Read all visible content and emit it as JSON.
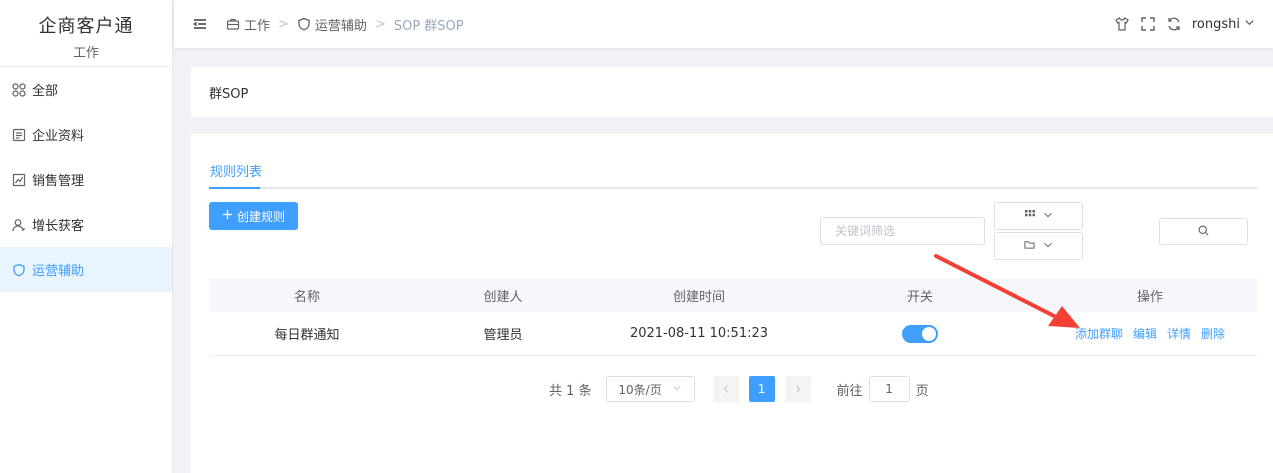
{
  "sidebar": {
    "brand_title": "企商客户通",
    "brand_sub": "工作",
    "items": [
      {
        "label": "全部",
        "icon": "grid-icon"
      },
      {
        "label": "企业资料",
        "icon": "document-icon"
      },
      {
        "label": "销售管理",
        "icon": "chart-icon"
      },
      {
        "label": "增长获客",
        "icon": "user-icon"
      },
      {
        "label": "运营辅助",
        "icon": "shield-icon",
        "active": true
      }
    ]
  },
  "header": {
    "breadcrumb": [
      "工作",
      "运营辅助",
      "SOP 群SOP"
    ],
    "username": "rongshi"
  },
  "page": {
    "title": "群SOP"
  },
  "tabs": [
    {
      "label": "规则列表",
      "active": true
    }
  ],
  "toolbar": {
    "create_label": "创建规则",
    "search_placeholder": "关键词筛选"
  },
  "table": {
    "headers": [
      "名称",
      "创建人",
      "创建时间",
      "开关",
      "操作"
    ],
    "rows": [
      {
        "name": "每日群通知",
        "creator": "管理员",
        "created_at": "2021-08-11 10:51:23",
        "enabled": true,
        "actions": [
          "添加群聊",
          "编辑",
          "详情",
          "删除"
        ]
      }
    ]
  },
  "pagination": {
    "total_label": "共 1 条",
    "page_size": "10条/页",
    "current_page": "1",
    "goto_prefix": "前往",
    "goto_value": "1",
    "goto_suffix": "页"
  },
  "colors": {
    "primary": "#409eff",
    "annotation": "#f04134"
  }
}
